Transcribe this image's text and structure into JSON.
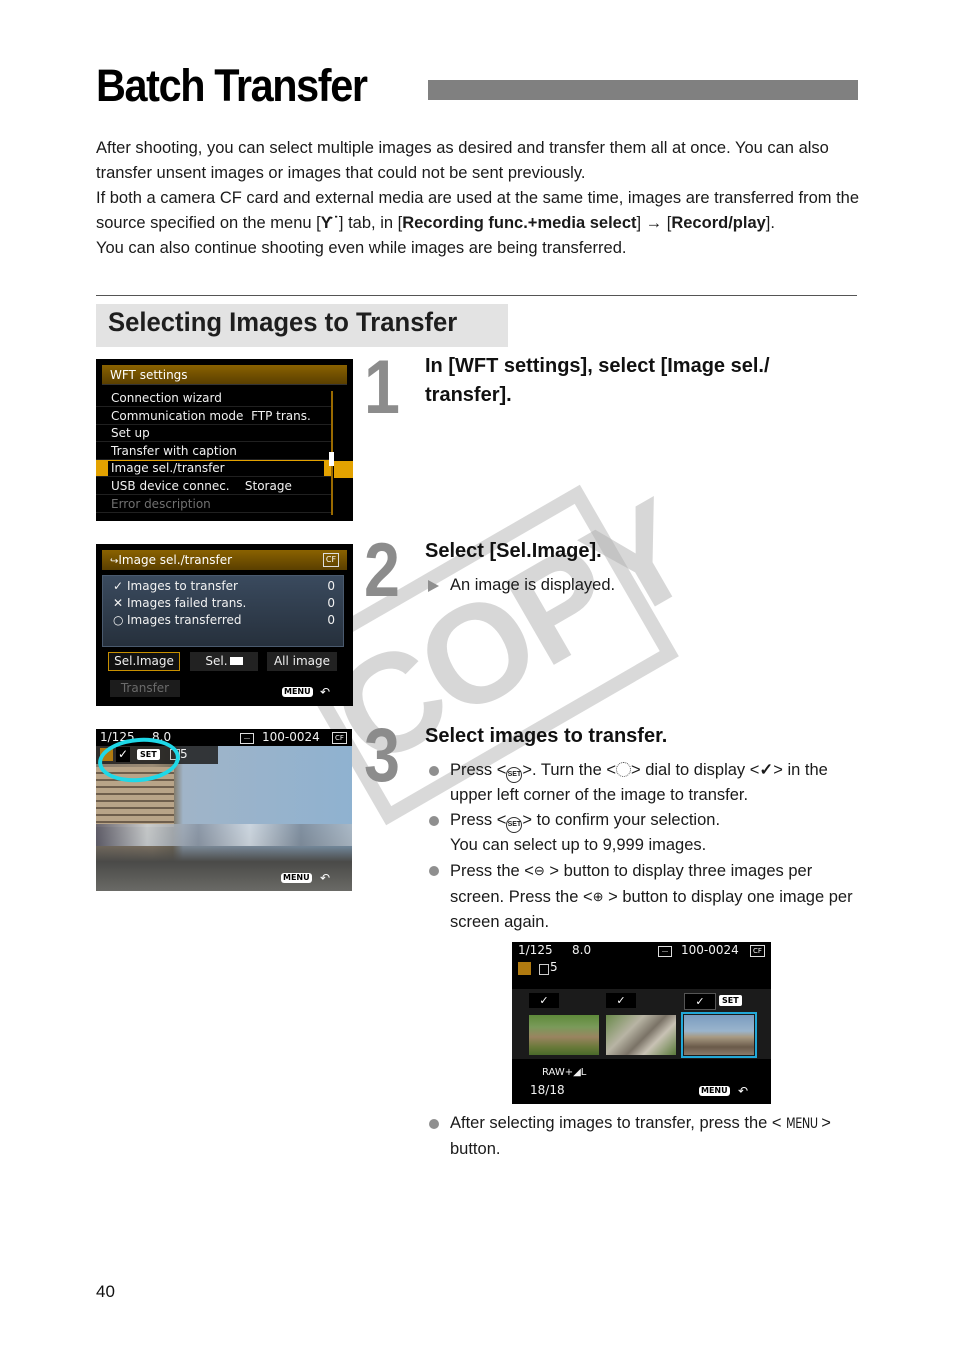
{
  "page": {
    "title": "Batch Transfer",
    "number": "40"
  },
  "intro": {
    "p1": "After shooting, you can select multiple images as desired and transfer them all at once. You can also transfer unsent images or images that could not be sent previously.",
    "p2_a": "If both a camera CF card and external media are used at the same time, images are transferred from the source specified on the menu [",
    "p2_icon": "Ƴ˙",
    "p2_b": "] tab, in [",
    "p2_bold1": "Recording func.+media select",
    "p2_c": "] → [",
    "p2_bold2": "Record/play",
    "p2_d": "].",
    "p3": "You can also continue shooting even while images are being transferred."
  },
  "section": {
    "heading": "Selecting Images to Transfer"
  },
  "steps": [
    {
      "number": "1",
      "title": "In [WFT settings], select [Image sel./ transfer]."
    },
    {
      "number": "2",
      "title": "Select [Sel.Image].",
      "result": "An image is displayed."
    },
    {
      "number": "3",
      "title": "Select images to transfer.",
      "bullets": {
        "b1_a": "Press <",
        "b1_set": "SET",
        "b1_b": ">. Turn the <",
        "b1_c": "> dial to display <",
        "b1_check": "✓",
        "b1_d": "> in the upper left corner of the image to transfer.",
        "b2_a": "Press <",
        "b2_set": "SET",
        "b2_b": "> to confirm your selection.",
        "b2_c": "You can select up to 9,999 images.",
        "b3_a": "Press the <",
        "b3_zoomout": "⊖",
        "b3_b": " > button to display three images per screen. Press the <",
        "b3_zoomin": "⊕",
        "b3_c": " > button to display one image per screen again.",
        "b4_a": "After selecting images to transfer, press the <",
        "b4_menu": "MENU",
        "b4_b": "> button."
      }
    }
  ],
  "screen_wft": {
    "header": "WFT settings",
    "items": [
      {
        "label": "Connection wizard",
        "value": ""
      },
      {
        "label": "Communication mode",
        "value": "FTP trans."
      },
      {
        "label": "Set up",
        "value": ""
      },
      {
        "label": "Transfer with caption",
        "value": ""
      },
      {
        "label": "Image sel./transfer",
        "value": "",
        "selected": true
      },
      {
        "label": "USB device connec.",
        "value": "Storage"
      },
      {
        "label": "Error description",
        "value": "",
        "disabled": true
      }
    ]
  },
  "screen_imagesel": {
    "header": "Image sel./transfer",
    "card": "CF",
    "rows": [
      {
        "icon": "✓",
        "label": "Images to transfer",
        "value": "0"
      },
      {
        "icon": "✕",
        "label": "Images failed trans.",
        "value": "0"
      },
      {
        "icon": "○",
        "label": "Images transferred",
        "value": "0"
      }
    ],
    "buttons": {
      "sel_image": "Sel.Image",
      "sel_folder": "Sel.",
      "all_image": "All image",
      "transfer": "Transfer"
    },
    "menu_tag": "MENU",
    "back": "⮌"
  },
  "screen_single": {
    "shutter": "1/125",
    "aperture": "8.0",
    "file_no": "100-0024",
    "card": "CF",
    "set_tag": "SET",
    "check": "✓",
    "count": "5",
    "menu_tag": "MENU"
  },
  "screen_triple": {
    "shutter": "1/125",
    "aperture": "8.0",
    "file_no": "100-0024",
    "card": "CF",
    "count": "5",
    "checks": [
      "✓",
      "✓",
      "✓"
    ],
    "set_tag": "SET",
    "quality": "RAW+◢L",
    "index": "18/18",
    "menu_tag": "MENU"
  },
  "watermark": "COPY",
  "colors": {
    "title_bar": "#808080",
    "section_bg": "#e3e3e3",
    "cam_highlight": "#e3a200",
    "selection_circle": "#1ed8e8"
  }
}
